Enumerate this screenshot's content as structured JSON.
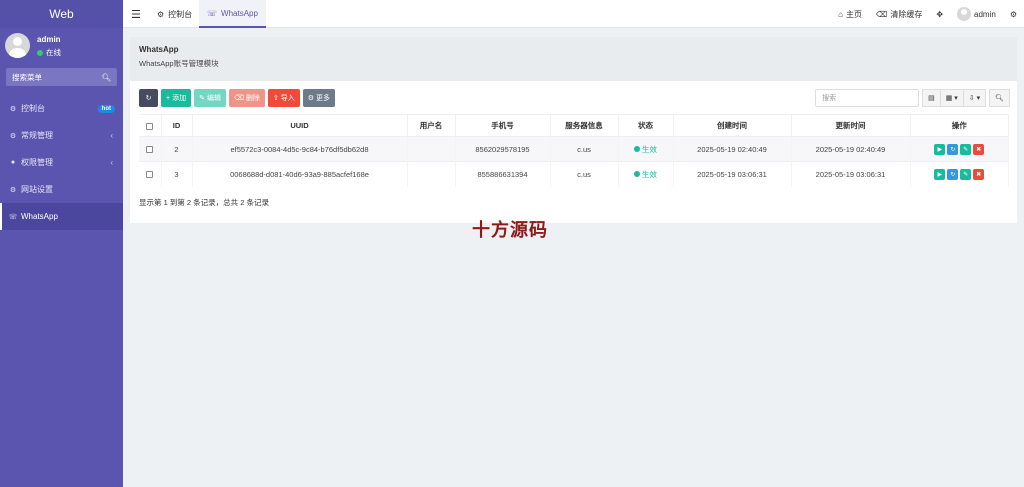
{
  "app": {
    "brand": "Web"
  },
  "user": {
    "name": "admin",
    "status": "在线"
  },
  "sidebar": {
    "search_label": "搜索菜单",
    "items": [
      {
        "label": "控制台",
        "badge": "hot"
      },
      {
        "label": "常规管理"
      },
      {
        "label": "权限管理"
      },
      {
        "label": "网站设置"
      },
      {
        "label": "WhatsApp"
      }
    ]
  },
  "topbar": {
    "tabs": [
      {
        "label": "控制台"
      },
      {
        "label": "WhatsApp"
      }
    ],
    "home": "主页",
    "clear_cache": "清除缓存",
    "user": "admin"
  },
  "page": {
    "title": "WhatsApp",
    "description": "WhatsApp账号管理模块"
  },
  "toolbar": {
    "add": "添加",
    "edit": "编辑",
    "delete": "删除",
    "import": "导入",
    "more": "更多"
  },
  "search": {
    "placeholder": "搜索"
  },
  "table": {
    "headers": [
      "ID",
      "UUID",
      "用户名",
      "手机号",
      "服务器信息",
      "状态",
      "创建时间",
      "更新时间",
      "操作"
    ],
    "rows": [
      {
        "id": "2",
        "uuid": "ef5572c3-0084-4d5c-9c84-b76df5db62d8",
        "username": "",
        "phone": "8562029578195",
        "server": "c.us",
        "status": "生效",
        "created": "2025-05-19 02:40:49",
        "updated": "2025-05-19 02:40:49"
      },
      {
        "id": "3",
        "uuid": "0068688d-d081-40d6-93a9-885acfef168e",
        "username": "",
        "phone": "855886631394",
        "server": "c.us",
        "status": "生效",
        "created": "2025-05-19 03:06:31",
        "updated": "2025-05-19 03:06:31"
      }
    ],
    "summary": "显示第 1 到第 2 条记录，总共 2 条记录"
  },
  "watermark": "十方源码",
  "colors": {
    "sidebar": "#5b55b0",
    "success": "#18bc9c",
    "danger": "#e74c3c",
    "primary": "#3498db"
  }
}
